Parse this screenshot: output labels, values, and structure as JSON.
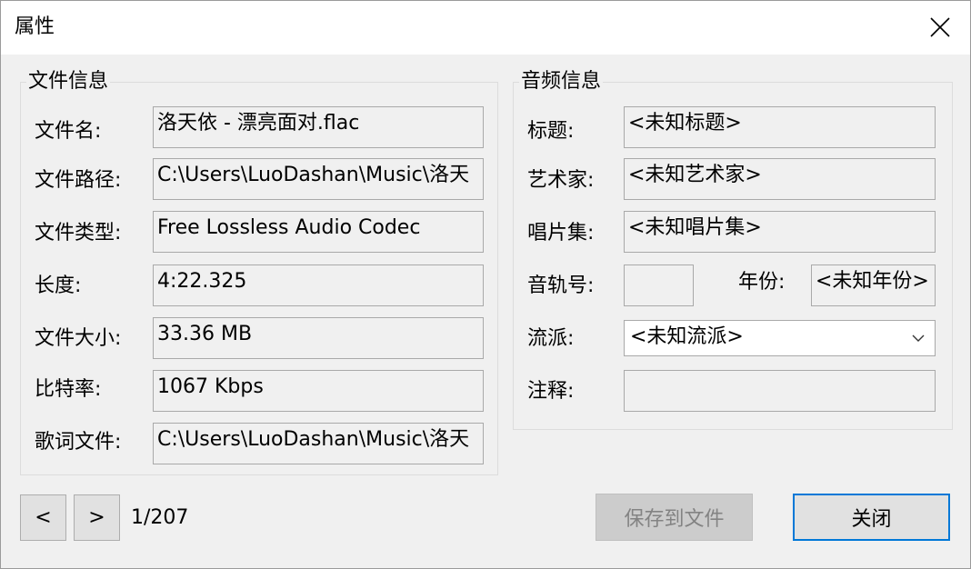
{
  "window": {
    "title": "属性"
  },
  "file_info": {
    "group_title": "文件信息",
    "rows": [
      {
        "label": "文件名:",
        "value": "洛天依 - 漂亮面对.flac"
      },
      {
        "label": "文件路径:",
        "value": "C:\\Users\\LuoDashan\\Music\\洛天"
      },
      {
        "label": "文件类型:",
        "value": "Free Lossless Audio Codec"
      },
      {
        "label": "长度:",
        "value": "4:22.325"
      },
      {
        "label": "文件大小:",
        "value": "33.36 MB"
      },
      {
        "label": "比特率:",
        "value": "1067 Kbps"
      },
      {
        "label": "歌词文件:",
        "value": "C:\\Users\\LuoDashan\\Music\\洛天"
      }
    ]
  },
  "audio_info": {
    "group_title": "音频信息",
    "title": {
      "label": "标题:",
      "value": "<未知标题>"
    },
    "artist": {
      "label": "艺术家:",
      "value": "<未知艺术家>"
    },
    "album": {
      "label": "唱片集:",
      "value": "<未知唱片集>"
    },
    "track": {
      "label": "音轨号:",
      "value": ""
    },
    "year": {
      "label": "年份:",
      "value": "<未知年份>"
    },
    "genre": {
      "label": "流派:",
      "value": "<未知流派>"
    },
    "comment": {
      "label": "注释:",
      "value": ""
    }
  },
  "footer": {
    "prev_label": "<",
    "next_label": ">",
    "page_indicator": "1/207",
    "save_label": "保存到文件",
    "close_label": "关闭"
  },
  "icons": {
    "close": "close-icon",
    "dropdown": "chevron-down-icon"
  }
}
